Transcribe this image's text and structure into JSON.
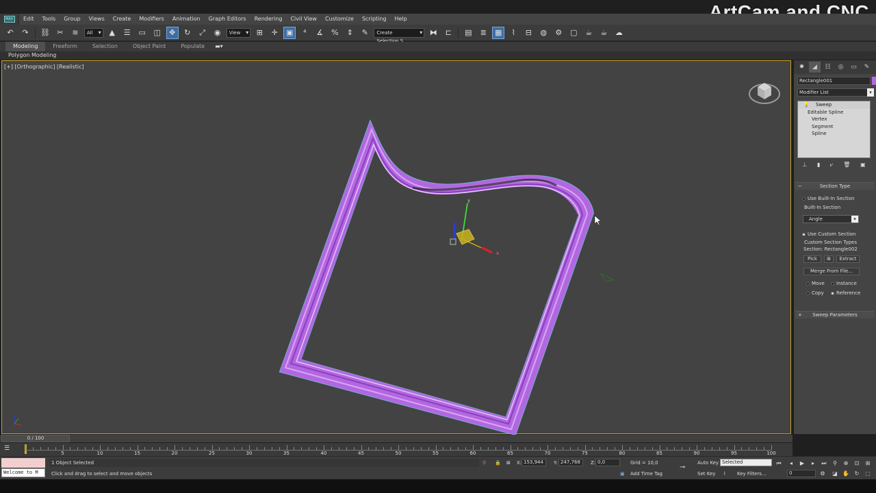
{
  "watermark": "ArtCam and CNC",
  "menu": [
    "Edit",
    "Tools",
    "Group",
    "Views",
    "Create",
    "Modifiers",
    "Animation",
    "Graph Editors",
    "Rendering",
    "Civil View",
    "Customize",
    "Scripting",
    "Help"
  ],
  "toolbar": {
    "filter_value": "All",
    "refcoord_value": "View",
    "selection_set_placeholder": "Create Selection S"
  },
  "ribbon": {
    "tabs": [
      "Modeling",
      "Freeform",
      "Selection",
      "Object Paint",
      "Populate"
    ],
    "sub_label": "Polygon Modeling"
  },
  "viewport": {
    "label": "[+] [Orthographic] [Realistic]"
  },
  "command_panel": {
    "object_name": "Rectangle001",
    "object_color": "#b267e0",
    "modifier_list_label": "Modifier List",
    "stack": [
      "Sweep",
      "Editable Spline",
      "Vertex",
      "Segment",
      "Spline"
    ],
    "section_type": {
      "title": "Section Type",
      "use_builtin": "Use Built-In Section",
      "builtin_label": "Built-In Section",
      "builtin_value": "Angle",
      "use_custom": "Use Custom Section",
      "custom_types_label": "Custom Section Types",
      "section_label": "Section: Rectangle002",
      "pick": "Pick",
      "extract": "Extract",
      "merge": "Merge From File...",
      "move": "Move",
      "instance": "Instance",
      "copy": "Copy",
      "reference": "Reference"
    },
    "sweep_params_title": "Sweep Parameters"
  },
  "timeline": {
    "frame_display": "0 / 100",
    "ticks": [
      "5",
      "10",
      "15",
      "20",
      "25",
      "30",
      "35",
      "40",
      "45",
      "50",
      "55",
      "60",
      "65",
      "70",
      "75",
      "80",
      "85",
      "90",
      "95",
      "100"
    ]
  },
  "status": {
    "maxscript_text": "Welcome to M",
    "selection_info": "1 Object Selected",
    "prompt": "Click and drag to select and move objects",
    "x_label": "X:",
    "x_value": "153,944",
    "y_label": "Y:",
    "y_value": "247,768",
    "z_label": "Z:",
    "z_value": "0,0",
    "grid": "Grid = 10,0",
    "add_time_tag": "Add Time Tag",
    "auto_key": "Auto Key",
    "set_key": "Set Key",
    "key_mode_value": "Selected",
    "key_filters": "Key Filters...",
    "current_frame": "0"
  },
  "colors": {
    "sweep_object": "#b267e0",
    "viewport_bg": "#434343",
    "active_border": "#c8a227"
  }
}
